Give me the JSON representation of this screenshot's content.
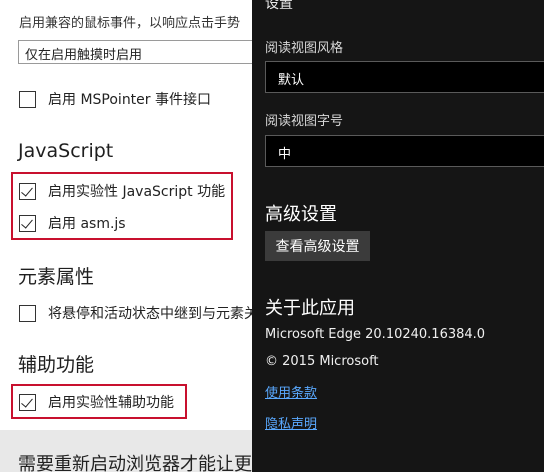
{
  "left": {
    "compat_desc": "启用兼容的鼠标事件，以响应点击手势",
    "touch_dropdown_value": "仅在启用触摸时启用",
    "mspointer_label": "启用 MSPointer 事件接口",
    "js_heading": "JavaScript",
    "exp_js_label": "启用实验性 JavaScript 功能",
    "asmjs_label": "启用 asm.js",
    "element_heading": "元素属性",
    "hover_label": "将悬停和活动状态中继到与元素关联",
    "a11y_heading": "辅助功能",
    "exp_a11y_label": "启用实验性辅助功能",
    "restart_banner": "需要重新启动浏览器才能让更改生效"
  },
  "right": {
    "title": "设置",
    "reading_style_label": "阅读视图风格",
    "reading_style_value": "默认",
    "reading_font_label": "阅读视图字号",
    "reading_font_value": "中",
    "advanced_heading": "高级设置",
    "advanced_button": "查看高级设置",
    "about_heading": "关于此应用",
    "version": "Microsoft Edge 20.10240.16384.0",
    "copyright": "© 2015 Microsoft",
    "terms_link": "使用条款",
    "privacy_link": "隐私声明"
  },
  "colors": {
    "highlight_red": "#c8102e",
    "dark_panel": "#151515",
    "link_blue": "#5aa9ff"
  }
}
